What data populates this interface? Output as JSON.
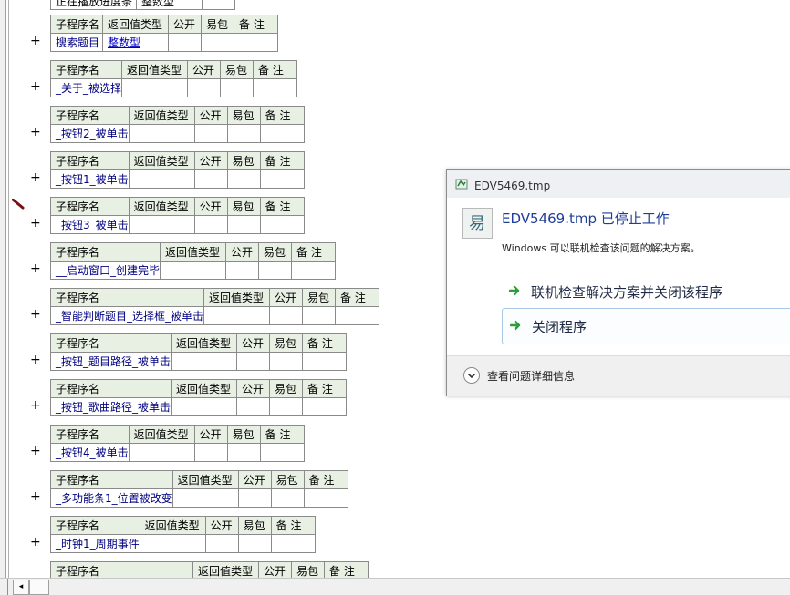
{
  "header_labels": {
    "name": "子程序名",
    "return_type": "返回值类型",
    "public": "公开",
    "easy": "易包",
    "note": "备 注"
  },
  "expand_symbol": "+",
  "partial_top": {
    "name": "正在播放进度条",
    "type": "整数型"
  },
  "subroutines": [
    {
      "name": "搜索题目",
      "return_type": "整数型"
    },
    {
      "name": "_关于_被选择",
      "return_type": ""
    },
    {
      "name": "_按钮2_被单击",
      "return_type": ""
    },
    {
      "name": "_按钮1_被单击",
      "return_type": ""
    },
    {
      "name": "_按钮3_被单击",
      "return_type": ""
    },
    {
      "name": "__启动窗口_创建完毕",
      "return_type": ""
    },
    {
      "name": "_智能判断题目_选择框_被单击",
      "return_type": ""
    },
    {
      "name": "_按钮_题目路径_被单击",
      "return_type": ""
    },
    {
      "name": "_按钮_歌曲路径_被单击",
      "return_type": ""
    },
    {
      "name": "_按钮4_被单击",
      "return_type": ""
    },
    {
      "name": "_多功能条1_位置被改变",
      "return_type": ""
    },
    {
      "name": "_时钟1_周期事件",
      "return_type": ""
    },
    {
      "name": "",
      "return_type": ""
    }
  ],
  "hscroll": {
    "left_arrow": "◂"
  },
  "dialog": {
    "title": "EDV5469.tmp",
    "heading": "EDV5469.tmp 已停止工作",
    "description": "Windows 可以联机检查该问题的解决方案。",
    "option_check": "联机检查解决方案并关闭该程序",
    "option_close": "关闭程序",
    "details": "查看问题详细信息"
  }
}
